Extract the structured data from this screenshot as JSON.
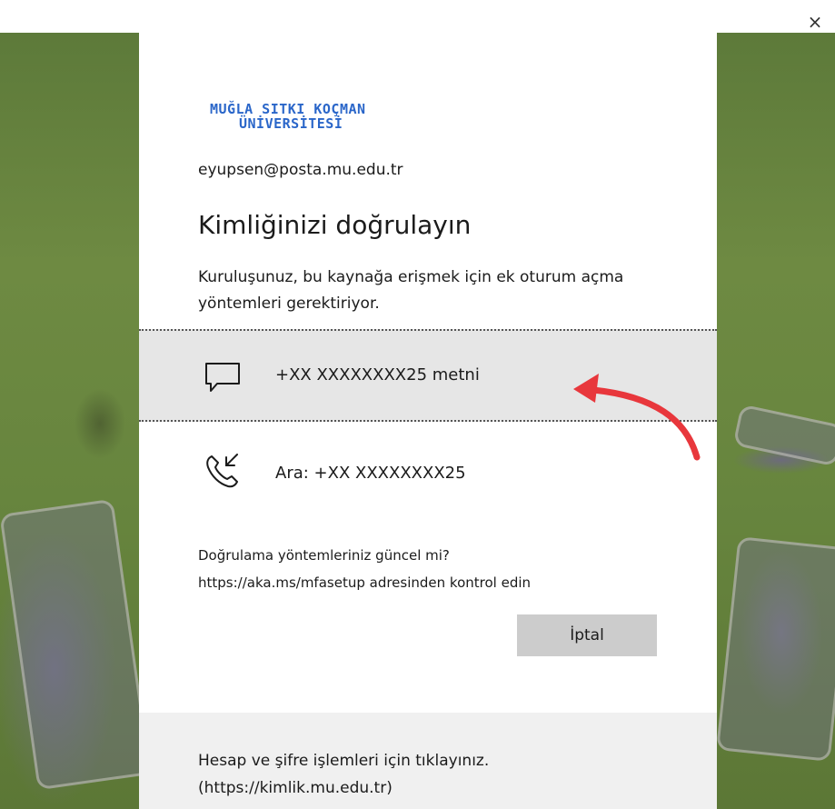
{
  "window": {
    "close_glyph": "×"
  },
  "logo": {
    "line1": "MUĞLA SITKI KOÇMAN",
    "line2": "ÜNİVERSİTESİ",
    "color": "#2a66c9"
  },
  "account": {
    "email": "eyupsen@posta.mu.edu.tr"
  },
  "heading": "Kimliğinizi doğrulayın",
  "description": "Kuruluşunuz, bu kaynağa erişmek için ek oturum açma yöntemleri gerektiriyor.",
  "options": [
    {
      "icon": "sms-message-icon",
      "label": "+XX XXXXXXXX25 metni",
      "selected": true
    },
    {
      "icon": "phone-call-icon",
      "label": "Ara: +XX XXXXXXXX25",
      "selected": false
    }
  ],
  "hint": {
    "line1": "Doğrulama yöntemleriniz güncel mi?",
    "line2": "https://aka.ms/mfasetup adresinden kontrol edin"
  },
  "cancel_label": "İptal",
  "footer": {
    "line1": "Hesap ve şifre işlemleri için tıklayınız.",
    "line2": "(https://kimlik.mu.edu.tr)"
  },
  "colors": {
    "selected_bg": "#e6e6e6",
    "cancel_bg": "#cccccc",
    "footer_bg": "#f0f0f0",
    "arrow": "#e8373c"
  }
}
